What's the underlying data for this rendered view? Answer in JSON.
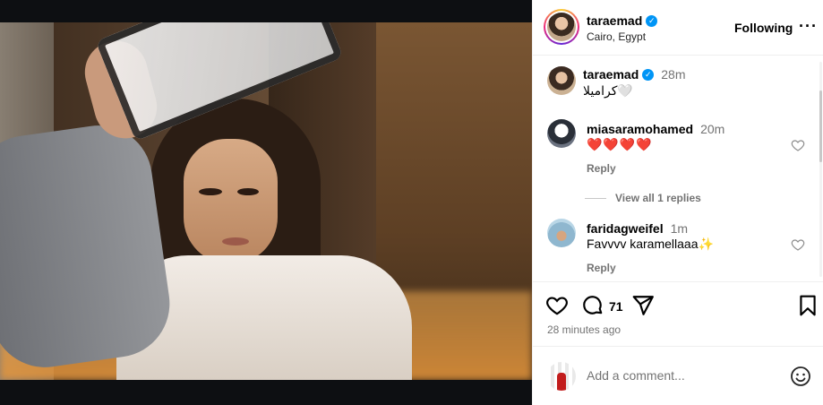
{
  "post": {
    "author": "taraemad",
    "location": "Cairo, Egypt",
    "follow_label": "Following",
    "more_label": "···",
    "caption": {
      "username": "taraemad",
      "time": "28m",
      "text": "كراميلا🤍"
    },
    "comments": [
      {
        "username": "miasaramohamed",
        "time": "20m",
        "text": "❤️❤️❤️❤️",
        "reply_label": "Reply",
        "view_replies": "View all 1 replies"
      },
      {
        "username": "faridagweifel",
        "time": "1m",
        "text": "Favvvv karamellaaa✨",
        "reply_label": "Reply"
      }
    ],
    "comment_count": "71",
    "time_ago": "28 minutes ago",
    "add_comment_placeholder": "Add a comment..."
  },
  "colors": {
    "verified": "#0095f6",
    "muted": "#737373",
    "heart_red": "#ed1c24"
  },
  "icons": {
    "like": "heart-icon",
    "comment": "comment-bubble-icon",
    "share": "paper-plane-icon",
    "save": "bookmark-icon",
    "emoji": "smiley-icon",
    "more": "more-dots-icon"
  }
}
